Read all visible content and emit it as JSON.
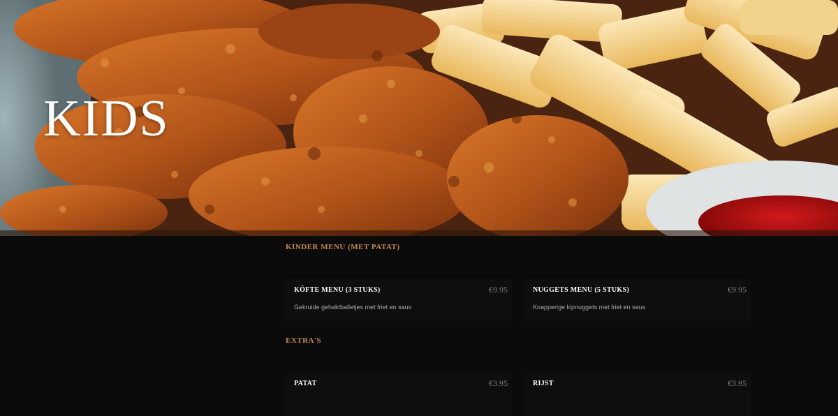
{
  "hero": {
    "title": "KIDS"
  },
  "sections": [
    {
      "title": "KINDER MENU (MET PATAT)",
      "items": [
        {
          "name": "KÖFTE MENU (3 STUKS)",
          "price": "€9.95",
          "description": "Gekruide gehaktballetjes met friet en saus"
        },
        {
          "name": "NUGGETS MENU (5 STUKS)",
          "price": "€9.95",
          "description": "Knapperige kipnuggets met friet en saus"
        }
      ]
    },
    {
      "title": "EXTRA'S",
      "items": [
        {
          "name": "PATAT",
          "price": "€3.95",
          "description": ""
        },
        {
          "name": "RIJST",
          "price": "€3.95",
          "description": ""
        }
      ]
    }
  ],
  "colors": {
    "accent": "#c8894a",
    "background": "#0b0b0b",
    "price": "#7d7d7d"
  }
}
